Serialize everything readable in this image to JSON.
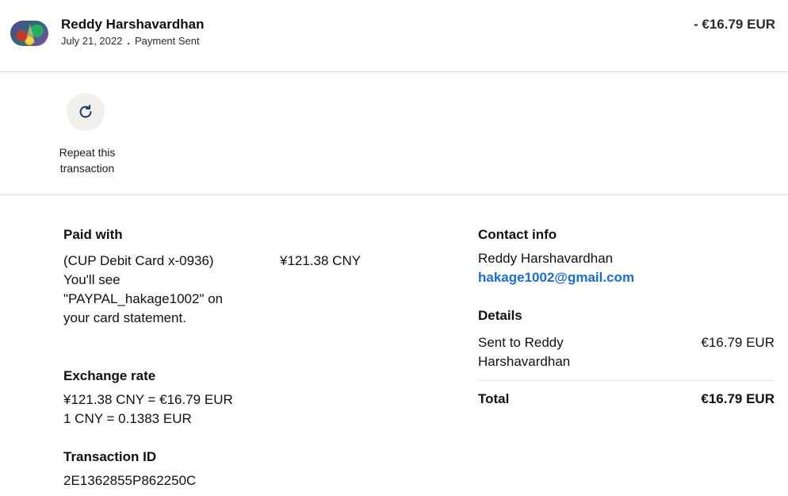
{
  "header": {
    "name": "Reddy Harshavardhan",
    "date": "July 21, 2022",
    "separator": ".",
    "status": "Payment Sent",
    "amount": "- €16.79 EUR"
  },
  "actions": {
    "repeat_label": "Repeat this transaction",
    "repeat_icon": "refresh-icon"
  },
  "paid_with": {
    "title": "Paid with",
    "card_text": "(CUP Debit Card x-0936) You'll see \"PAYPAL_hakage1002\" on your card statement.",
    "amount": "¥121.38 CNY"
  },
  "exchange_rate": {
    "title": "Exchange rate",
    "line1": "¥121.38 CNY = €16.79 EUR",
    "line2": "1 CNY = 0.1383 EUR"
  },
  "transaction": {
    "title": "Transaction ID",
    "id": "2E1362855P862250C"
  },
  "contact": {
    "title": "Contact info",
    "name": "Reddy Harshavardhan",
    "email": "hakage1002@gmail.com"
  },
  "details": {
    "title": "Details",
    "sent_to": "Sent to Reddy Harshavardhan",
    "sent_amount": "€16.79 EUR",
    "total_label": "Total",
    "total_amount": "€16.79 EUR"
  },
  "colors": {
    "link": "#1a6dd4",
    "icon": "#1b3a6b",
    "button_bg": "#f2f0ec"
  }
}
